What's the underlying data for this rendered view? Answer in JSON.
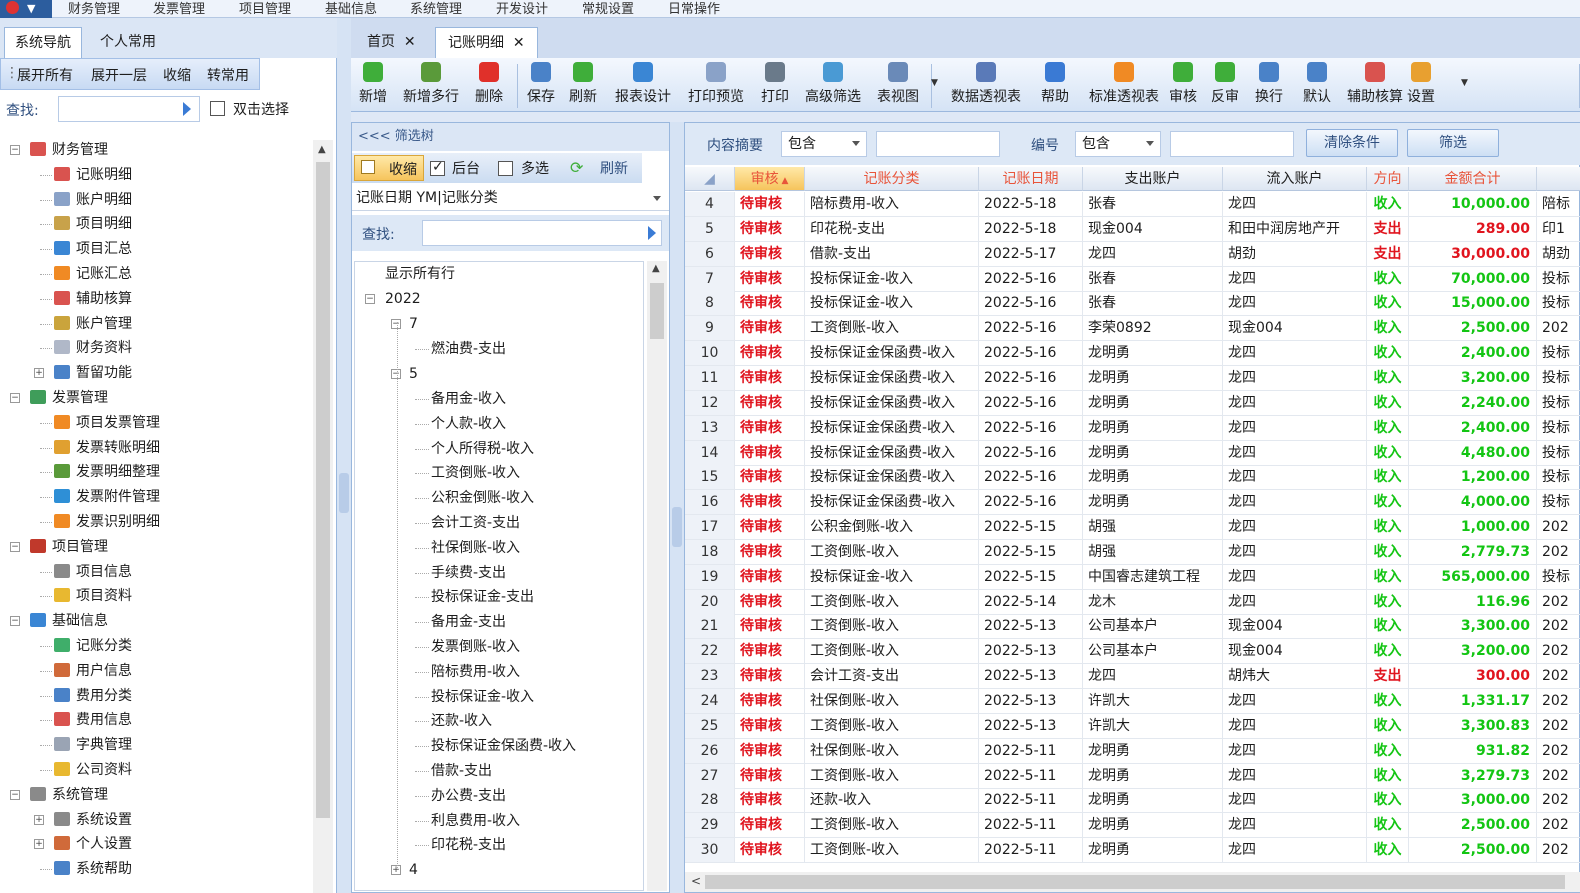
{
  "menubar": {
    "items": [
      "财务管理",
      "发票管理",
      "项目管理",
      "基础信息",
      "系统管理",
      "开发设计",
      "常规设置",
      "日常操作"
    ]
  },
  "left": {
    "tabs": [
      "系统导航",
      "个人常用"
    ],
    "actions": [
      "展开所有",
      "展开一层",
      "收缩",
      "转常用"
    ],
    "search_label": "查找:",
    "dbl_select": "双击选择",
    "tree": [
      {
        "label": "财务管理",
        "level": 0,
        "icon": "ledger-icon",
        "color": "#d9534f"
      },
      {
        "label": "记账明细",
        "level": 1,
        "icon": "ledger-detail-icon",
        "color": "#d9534f"
      },
      {
        "label": "账户明细",
        "level": 1,
        "icon": "account-icon",
        "color": "#8aa2c8"
      },
      {
        "label": "项目明细",
        "level": 1,
        "icon": "edit-icon",
        "color": "#c8a24a"
      },
      {
        "label": "项目汇总",
        "level": 1,
        "icon": "home-icon",
        "color": "#3a86d4"
      },
      {
        "label": "记账汇总",
        "level": 1,
        "icon": "bar-chart-icon",
        "color": "#f08a24"
      },
      {
        "label": "辅助核算",
        "level": 1,
        "icon": "wand-icon",
        "color": "#d9534f"
      },
      {
        "label": "账户管理",
        "level": 1,
        "icon": "book-icon",
        "color": "#caa43c"
      },
      {
        "label": "财务资料",
        "level": 1,
        "icon": "document-icon",
        "color": "#b0b8c8"
      },
      {
        "label": "暂留功能",
        "level": 1,
        "icon": "folder-icon",
        "color": "#4a82c8"
      },
      {
        "label": "发票管理",
        "level": 0,
        "icon": "invoice-icon",
        "color": "#3f9d5a"
      },
      {
        "label": "项目发票管理",
        "level": 1,
        "icon": "bar-chart-icon",
        "color": "#f08a24"
      },
      {
        "label": "发票转账明细",
        "level": 1,
        "icon": "transfer-icon",
        "color": "#e0a030"
      },
      {
        "label": "发票明细整理",
        "level": 1,
        "icon": "gear-doc-icon",
        "color": "#5a9a3a"
      },
      {
        "label": "发票附件管理",
        "level": 1,
        "icon": "attach-icon",
        "color": "#2e8fd6"
      },
      {
        "label": "发票识别明细",
        "level": 1,
        "icon": "refresh-icon",
        "color": "#f08a24"
      },
      {
        "label": "项目管理",
        "level": 0,
        "icon": "project-icon",
        "color": "#c0392b"
      },
      {
        "label": "项目信息",
        "level": 1,
        "icon": "bank-icon",
        "color": "#8a8a8a"
      },
      {
        "label": "项目资料",
        "level": 1,
        "icon": "folder-icon",
        "color": "#e8b830"
      },
      {
        "label": "基础信息",
        "level": 0,
        "icon": "wrench-icon",
        "color": "#3a86d4"
      },
      {
        "label": "记账分类",
        "level": 1,
        "icon": "book-icon",
        "color": "#3fae6a"
      },
      {
        "label": "用户信息",
        "level": 1,
        "icon": "user-icon",
        "color": "#d06a3a"
      },
      {
        "label": "费用分类",
        "level": 1,
        "icon": "table-icon",
        "color": "#4a82c8"
      },
      {
        "label": "费用信息",
        "level": 1,
        "icon": "tools-icon",
        "color": "#d9534f"
      },
      {
        "label": "字典管理",
        "level": 1,
        "icon": "document-icon",
        "color": "#9aa4b4"
      },
      {
        "label": "公司资料",
        "level": 1,
        "icon": "note-icon",
        "color": "#e8b830"
      },
      {
        "label": "系统管理",
        "level": 0,
        "icon": "gear-icon",
        "color": "#8a8a8a"
      },
      {
        "label": "系统设置",
        "level": 1,
        "icon": "gear-icon",
        "color": "#8a8a8a"
      },
      {
        "label": "个人设置",
        "level": 1,
        "icon": "user-icon",
        "color": "#d06a3a"
      },
      {
        "label": "系统帮助",
        "level": 1,
        "icon": "help-book-icon",
        "color": "#4a82c8"
      }
    ]
  },
  "doc_tabs": [
    "首页",
    "记账明细"
  ],
  "toolbar": [
    {
      "label": "新增",
      "icon": "add-icon",
      "color": "#3fae3a"
    },
    {
      "label": "新增多行",
      "icon": "add-rows-icon",
      "color": "#5a9a3a"
    },
    {
      "label": "删除",
      "icon": "delete-icon",
      "color": "#e0302a"
    },
    {
      "label": "保存",
      "icon": "save-icon",
      "color": "#4a82c8"
    },
    {
      "label": "刷新",
      "icon": "refresh-icon",
      "color": "#3fae3a"
    },
    {
      "label": "报表设计",
      "icon": "report-design-icon",
      "color": "#3a86d4"
    },
    {
      "label": "打印预览",
      "icon": "print-preview-icon",
      "color": "#8aa2c8"
    },
    {
      "label": "打印",
      "icon": "printer-icon",
      "color": "#6a7a8a"
    },
    {
      "label": "高级筛选",
      "icon": "filter-icon",
      "color": "#4a9ad4"
    },
    {
      "label": "表视图",
      "icon": "table-view-icon",
      "color": "#6a8ab8"
    },
    {
      "label": "数据透视表",
      "icon": "pivot-icon",
      "color": "#5a7ab8"
    },
    {
      "label": "帮助",
      "icon": "help-icon",
      "color": "#3a7ad4"
    },
    {
      "label": "标准透视表",
      "icon": "bar-chart-icon",
      "color": "#f08a24"
    },
    {
      "label": "审核",
      "icon": "approve-icon",
      "color": "#3fae3a"
    },
    {
      "label": "反审",
      "icon": "unapprove-icon",
      "color": "#3fae3a"
    },
    {
      "label": "换行",
      "icon": "wrap-icon",
      "color": "#4a82c8"
    },
    {
      "label": "默认",
      "icon": "default-sort-icon",
      "color": "#4a82c8"
    },
    {
      "label": "辅助核算",
      "icon": "wand-icon",
      "color": "#d9534f"
    },
    {
      "label": "设置",
      "icon": "wrench-icon",
      "color": "#e8a030"
    }
  ],
  "filter": {
    "header": "<<< 筛选树",
    "collapse": "收缩",
    "backend": "后台",
    "multi": "多选",
    "refresh": "刷新",
    "grouping": "记账日期 YM|记账分类",
    "search_label": "查找:",
    "show_all": "显示所有行",
    "year": "2022",
    "month7": "7",
    "month7_items": [
      "燃油费-支出"
    ],
    "month5": "5",
    "month5_items": [
      "备用金-收入",
      "个人款-收入",
      "个人所得税-收入",
      "工资倒账-收入",
      "公积金倒账-收入",
      "会计工资-支出",
      "社保倒账-收入",
      "手续费-支出",
      "投标保证金-支出",
      "备用金-支出",
      "发票倒账-收入",
      "陪标费用-收入",
      "投标保证金-收入",
      "还款-收入",
      "投标保证金保函费-收入",
      "借款-支出",
      "办公费-支出",
      "利息费用-收入",
      "印花税-支出"
    ],
    "month4": "4"
  },
  "query": {
    "field1_label": "内容摘要",
    "field1_op": "包含",
    "field2_label": "编号",
    "field2_op": "包含",
    "clear_btn": "清除条件",
    "filter_btn": "筛选"
  },
  "colors": {
    "income": "#13c513",
    "expense": "#e0141e",
    "amount_income": "#13c513",
    "amount_expense": "#e0141e",
    "status": "#e0141e"
  },
  "grid": {
    "columns": [
      "审核",
      "记账分类",
      "记账日期",
      "支出账户",
      "流入账户",
      "方向",
      "金额合计"
    ],
    "rows": [
      {
        "no": "4",
        "status": "待审核",
        "category": "陪标费用-收入",
        "date": "2022-5-18",
        "out": "张春",
        "in": "龙四",
        "dir": "收入",
        "amount": "10,000.00",
        "extra": "陪标"
      },
      {
        "no": "5",
        "status": "待审核",
        "category": "印花税-支出",
        "date": "2022-5-18",
        "out": "现金004",
        "in": "和田中润房地产开",
        "dir": "支出",
        "amount": "289.00",
        "extra": "印1"
      },
      {
        "no": "6",
        "status": "待审核",
        "category": "借款-支出",
        "date": "2022-5-17",
        "out": "龙四",
        "in": "胡劲",
        "dir": "支出",
        "amount": "30,000.00",
        "extra": "胡劲"
      },
      {
        "no": "7",
        "status": "待审核",
        "category": "投标保证金-收入",
        "date": "2022-5-16",
        "out": "张春",
        "in": "龙四",
        "dir": "收入",
        "amount": "70,000.00",
        "extra": "投标"
      },
      {
        "no": "8",
        "status": "待审核",
        "category": "投标保证金-收入",
        "date": "2022-5-16",
        "out": "张春",
        "in": "龙四",
        "dir": "收入",
        "amount": "15,000.00",
        "extra": "投标"
      },
      {
        "no": "9",
        "status": "待审核",
        "category": "工资倒账-收入",
        "date": "2022-5-16",
        "out": "李荣0892",
        "in": "现金004",
        "dir": "收入",
        "amount": "2,500.00",
        "extra": "202"
      },
      {
        "no": "10",
        "status": "待审核",
        "category": "投标保证金保函费-收入",
        "date": "2022-5-16",
        "out": "龙明勇",
        "in": "龙四",
        "dir": "收入",
        "amount": "2,400.00",
        "extra": "投标"
      },
      {
        "no": "11",
        "status": "待审核",
        "category": "投标保证金保函费-收入",
        "date": "2022-5-16",
        "out": "龙明勇",
        "in": "龙四",
        "dir": "收入",
        "amount": "3,200.00",
        "extra": "投标"
      },
      {
        "no": "12",
        "status": "待审核",
        "category": "投标保证金保函费-收入",
        "date": "2022-5-16",
        "out": "龙明勇",
        "in": "龙四",
        "dir": "收入",
        "amount": "2,240.00",
        "extra": "投标"
      },
      {
        "no": "13",
        "status": "待审核",
        "category": "投标保证金保函费-收入",
        "date": "2022-5-16",
        "out": "龙明勇",
        "in": "龙四",
        "dir": "收入",
        "amount": "2,400.00",
        "extra": "投标"
      },
      {
        "no": "14",
        "status": "待审核",
        "category": "投标保证金保函费-收入",
        "date": "2022-5-16",
        "out": "龙明勇",
        "in": "龙四",
        "dir": "收入",
        "amount": "4,480.00",
        "extra": "投标"
      },
      {
        "no": "15",
        "status": "待审核",
        "category": "投标保证金保函费-收入",
        "date": "2022-5-16",
        "out": "龙明勇",
        "in": "龙四",
        "dir": "收入",
        "amount": "1,200.00",
        "extra": "投标"
      },
      {
        "no": "16",
        "status": "待审核",
        "category": "投标保证金保函费-收入",
        "date": "2022-5-16",
        "out": "龙明勇",
        "in": "龙四",
        "dir": "收入",
        "amount": "4,000.00",
        "extra": "投标"
      },
      {
        "no": "17",
        "status": "待审核",
        "category": "公积金倒账-收入",
        "date": "2022-5-15",
        "out": "胡强",
        "in": "龙四",
        "dir": "收入",
        "amount": "1,000.00",
        "extra": "202"
      },
      {
        "no": "18",
        "status": "待审核",
        "category": "工资倒账-收入",
        "date": "2022-5-15",
        "out": "胡强",
        "in": "龙四",
        "dir": "收入",
        "amount": "2,779.73",
        "extra": "202"
      },
      {
        "no": "19",
        "status": "待审核",
        "category": "投标保证金-收入",
        "date": "2022-5-15",
        "out": "中国睿志建筑工程",
        "in": "龙四",
        "dir": "收入",
        "amount": "565,000.00",
        "extra": "投标"
      },
      {
        "no": "20",
        "status": "待审核",
        "category": "工资倒账-收入",
        "date": "2022-5-14",
        "out": "龙木",
        "in": "龙四",
        "dir": "收入",
        "amount": "116.96",
        "extra": "202"
      },
      {
        "no": "21",
        "status": "待审核",
        "category": "工资倒账-收入",
        "date": "2022-5-13",
        "out": "公司基本户",
        "in": "现金004",
        "dir": "收入",
        "amount": "3,300.00",
        "extra": "202"
      },
      {
        "no": "22",
        "status": "待审核",
        "category": "工资倒账-收入",
        "date": "2022-5-13",
        "out": "公司基本户",
        "in": "现金004",
        "dir": "收入",
        "amount": "3,200.00",
        "extra": "202"
      },
      {
        "no": "23",
        "status": "待审核",
        "category": "会计工资-支出",
        "date": "2022-5-13",
        "out": "龙四",
        "in": "胡炜大",
        "dir": "支出",
        "amount": "300.00",
        "extra": "202"
      },
      {
        "no": "24",
        "status": "待审核",
        "category": "社保倒账-收入",
        "date": "2022-5-13",
        "out": "许凯大",
        "in": "龙四",
        "dir": "收入",
        "amount": "1,331.17",
        "extra": "202"
      },
      {
        "no": "25",
        "status": "待审核",
        "category": "工资倒账-收入",
        "date": "2022-5-13",
        "out": "许凯大",
        "in": "龙四",
        "dir": "收入",
        "amount": "3,300.83",
        "extra": "202"
      },
      {
        "no": "26",
        "status": "待审核",
        "category": "社保倒账-收入",
        "date": "2022-5-11",
        "out": "龙明勇",
        "in": "龙四",
        "dir": "收入",
        "amount": "931.82",
        "extra": "202"
      },
      {
        "no": "27",
        "status": "待审核",
        "category": "工资倒账-收入",
        "date": "2022-5-11",
        "out": "龙明勇",
        "in": "龙四",
        "dir": "收入",
        "amount": "3,279.73",
        "extra": "202"
      },
      {
        "no": "28",
        "status": "待审核",
        "category": "还款-收入",
        "date": "2022-5-11",
        "out": "龙明勇",
        "in": "龙四",
        "dir": "收入",
        "amount": "3,000.00",
        "extra": "202"
      },
      {
        "no": "29",
        "status": "待审核",
        "category": "工资倒账-收入",
        "date": "2022-5-11",
        "out": "龙明勇",
        "in": "龙四",
        "dir": "收入",
        "amount": "2,500.00",
        "extra": "202"
      },
      {
        "no": "30",
        "status": "待审核",
        "category": "工资倒账-收入",
        "date": "2022-5-11",
        "out": "龙明勇",
        "in": "龙四",
        "dir": "收入",
        "amount": "2,500.00",
        "extra": "202"
      }
    ]
  }
}
